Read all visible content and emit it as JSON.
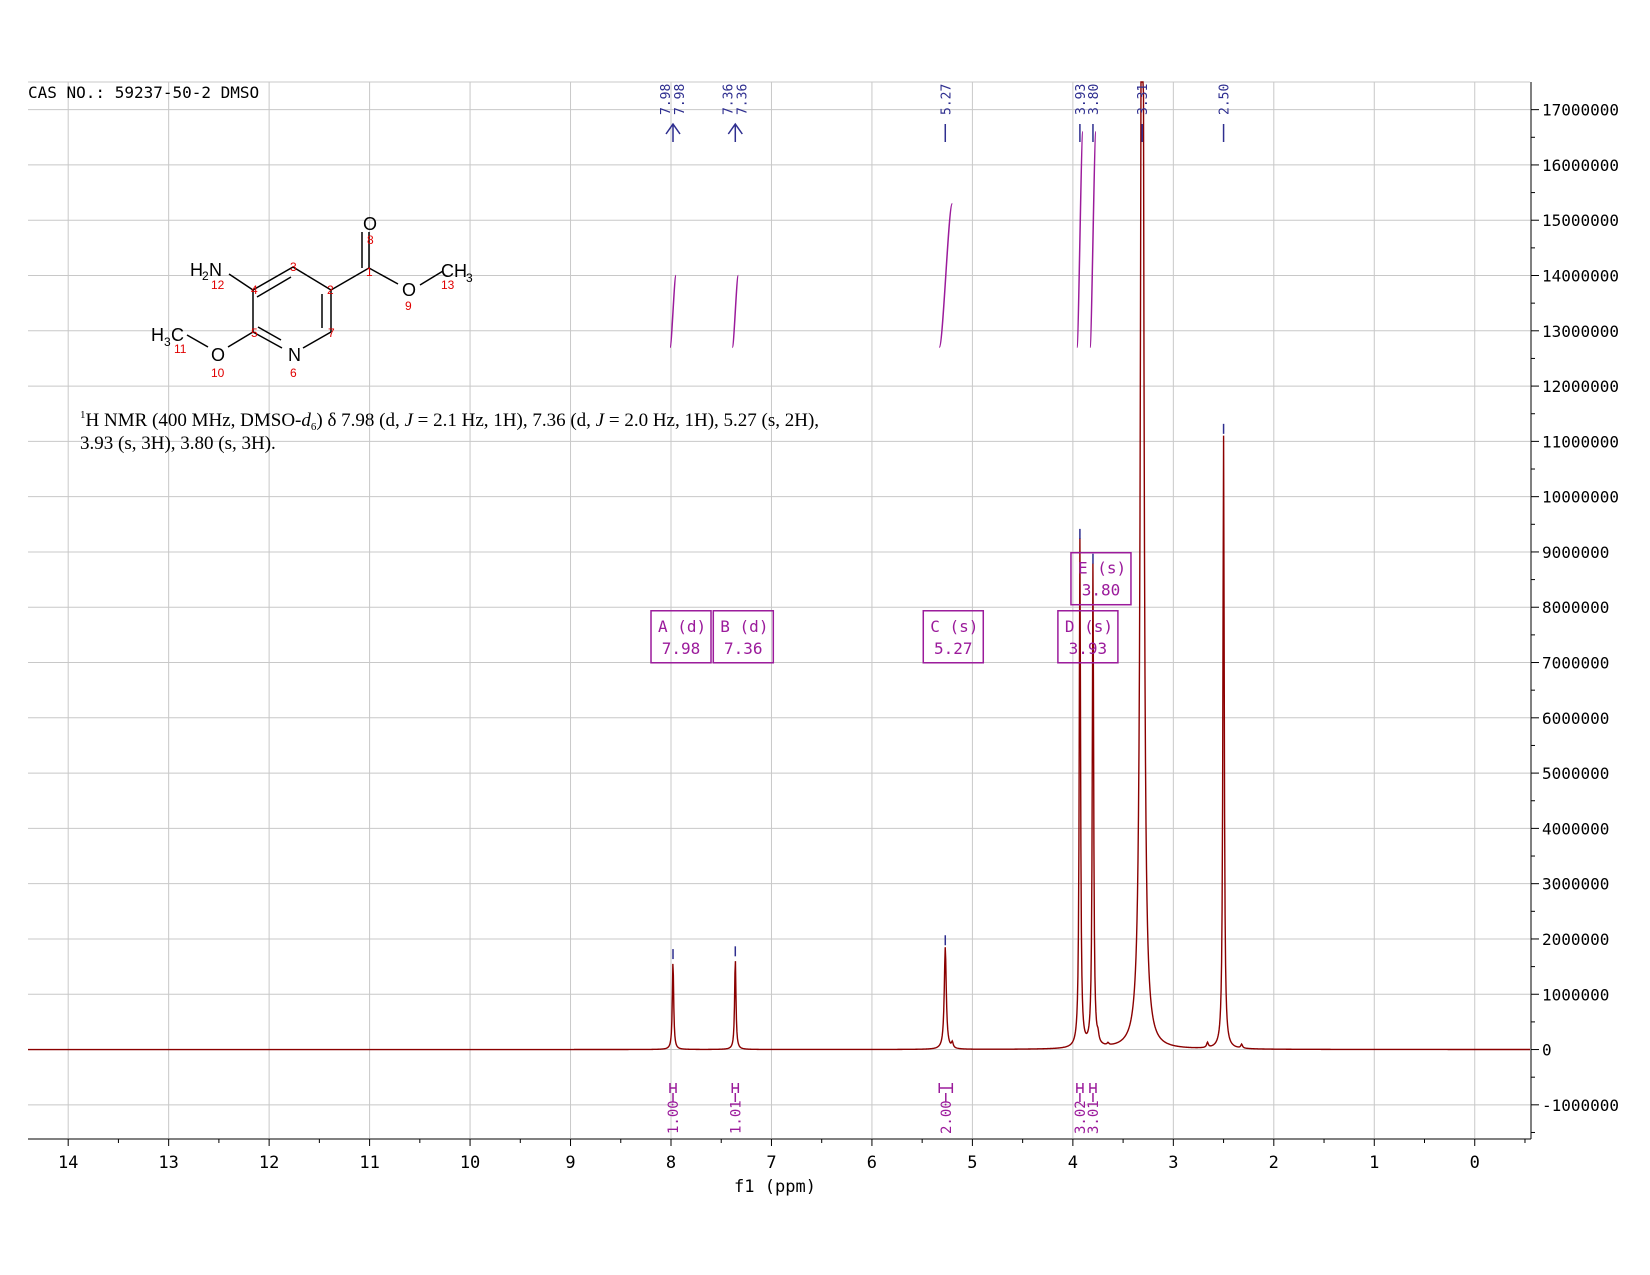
{
  "header": {
    "cas_label": "CAS NO.: 59237-50-2 DMSO"
  },
  "description": {
    "line1_prefix": "H NMR (400 MHz, DMSO-",
    "line1_sup": "1",
    "line1_d": "d",
    "line1_sub": "6",
    "line1_rest_a": ") δ 7.98 (d, ",
    "line1_J": "J",
    "line1_rest_b": " = 2.1 Hz, 1H), 7.36 (d, ",
    "line1_rest_c": " = 2.0 Hz, 1H), 5.27 (s, 2H),",
    "line2": "3.93 (s, 3H), 3.80 (s, 3H)."
  },
  "structure": {
    "atoms": {
      "nh2_H": "H",
      "nh2_2": "2",
      "nh2_N": "N",
      "ch3_C": "CH",
      "ch3_3": "3",
      "h3c_H": "H",
      "h3c_3": "3",
      "h3c_C": "C",
      "o_carbonyl": "O",
      "o_ester": "O",
      "o_ether": "O",
      "n_ring": "N"
    },
    "numbers": {
      "n1": "1",
      "n2": "2",
      "n3": "3",
      "n4": "4",
      "n5": "5",
      "n6": "6",
      "n7": "7",
      "n8": "8",
      "n9": "9",
      "n10": "10",
      "n11": "11",
      "n12": "12",
      "n13": "13"
    }
  },
  "colors": {
    "spectrum": "#8b0000",
    "peak_labels": "#2e2e8f",
    "integration": "#9b1b9b",
    "grid": "#c8c8c8"
  },
  "chart_data": {
    "type": "line",
    "xlabel": "f1 (ppm)",
    "ylabel": "",
    "xlim": [
      14.4,
      -0.55
    ],
    "ylim": [
      -1600000,
      17500000
    ],
    "x_ticks": [
      14,
      13,
      12,
      11,
      10,
      9,
      8,
      7,
      6,
      5,
      4,
      3,
      2,
      1,
      0
    ],
    "y_ticks": [
      -1000000,
      0,
      1000000,
      2000000,
      3000000,
      4000000,
      5000000,
      6000000,
      7000000,
      8000000,
      9000000,
      10000000,
      11000000,
      12000000,
      13000000,
      14000000,
      15000000,
      16000000,
      17000000
    ],
    "y_tick_labels": [
      "-1000000",
      "0",
      "1000000",
      "2000000",
      "3000000",
      "4000000",
      "5000000",
      "6000000",
      "7000000",
      "8000000",
      "9000000",
      "10000000",
      "11000000",
      "12000000",
      "13000000",
      "14000000",
      "15000000",
      "16000000",
      "17000000"
    ],
    "grid": true,
    "peaks": [
      {
        "ppm": 7.98,
        "height": 1600000,
        "width": 0.008
      },
      {
        "ppm": 7.36,
        "height": 1650000,
        "width": 0.008
      },
      {
        "ppm": 5.27,
        "height": 1850000,
        "width": 0.012
      },
      {
        "ppm": 3.93,
        "height": 9200000,
        "width": 0.008
      },
      {
        "ppm": 3.8,
        "height": 8750000,
        "width": 0.008
      },
      {
        "ppm": 3.31,
        "height": 30000000,
        "width": 0.015
      },
      {
        "ppm": 2.5,
        "height": 11100000,
        "width": 0.008
      },
      {
        "ppm": 5.2,
        "height": 100000,
        "width": 0.01
      },
      {
        "ppm": 2.66,
        "height": 90000,
        "width": 0.01
      },
      {
        "ppm": 2.32,
        "height": 70000,
        "width": 0.01
      },
      {
        "ppm": 3.75,
        "height": 120000,
        "width": 0.01
      },
      {
        "ppm": 3.65,
        "height": 40000,
        "width": 0.01
      }
    ],
    "peak_labels": [
      {
        "ppm": 7.98,
        "labels": [
          "7.98",
          "7.98"
        ]
      },
      {
        "ppm": 7.36,
        "labels": [
          "7.36",
          "7.36"
        ]
      },
      {
        "ppm": 5.27,
        "labels": [
          "5.27"
        ]
      },
      {
        "ppm": 3.93,
        "labels": [
          "3.93"
        ]
      },
      {
        "ppm": 3.8,
        "labels": [
          "3.80"
        ]
      },
      {
        "ppm": 3.31,
        "labels": [
          "3.31"
        ]
      },
      {
        "ppm": 2.5,
        "labels": [
          "2.50"
        ]
      }
    ],
    "multiplets": [
      {
        "letter": "A",
        "mult": "(d)",
        "shift": "7.98",
        "ppm": 7.98,
        "yval": 7900000
      },
      {
        "letter": "B",
        "mult": "(d)",
        "shift": "7.36",
        "ppm": 7.36,
        "yval": 7900000
      },
      {
        "letter": "C",
        "mult": "(s)",
        "shift": "5.27",
        "ppm": 5.27,
        "yval": 7900000
      },
      {
        "letter": "D",
        "mult": "(s)",
        "shift": "3.93",
        "ppm": 3.93,
        "yval": 7900000
      },
      {
        "letter": "E",
        "mult": "(s)",
        "shift": "3.80",
        "ppm": 3.8,
        "yval": 8950000
      }
    ],
    "integrals": [
      {
        "from": 8.01,
        "to": 7.95,
        "value": "1.00",
        "y0": 12700000,
        "y1": 14000000
      },
      {
        "from": 7.39,
        "to": 7.33,
        "value": "1.01",
        "y0": 12700000,
        "y1": 14000000
      },
      {
        "from": 5.33,
        "to": 5.2,
        "value": "2.00",
        "y0": 12700000,
        "y1": 15300000
      },
      {
        "from": 3.96,
        "to": 3.9,
        "value": "3.02",
        "y0": 12700000,
        "y1": 16600000
      },
      {
        "from": 3.83,
        "to": 3.77,
        "value": "3.01",
        "y0": 12700000,
        "y1": 16600000
      }
    ]
  }
}
